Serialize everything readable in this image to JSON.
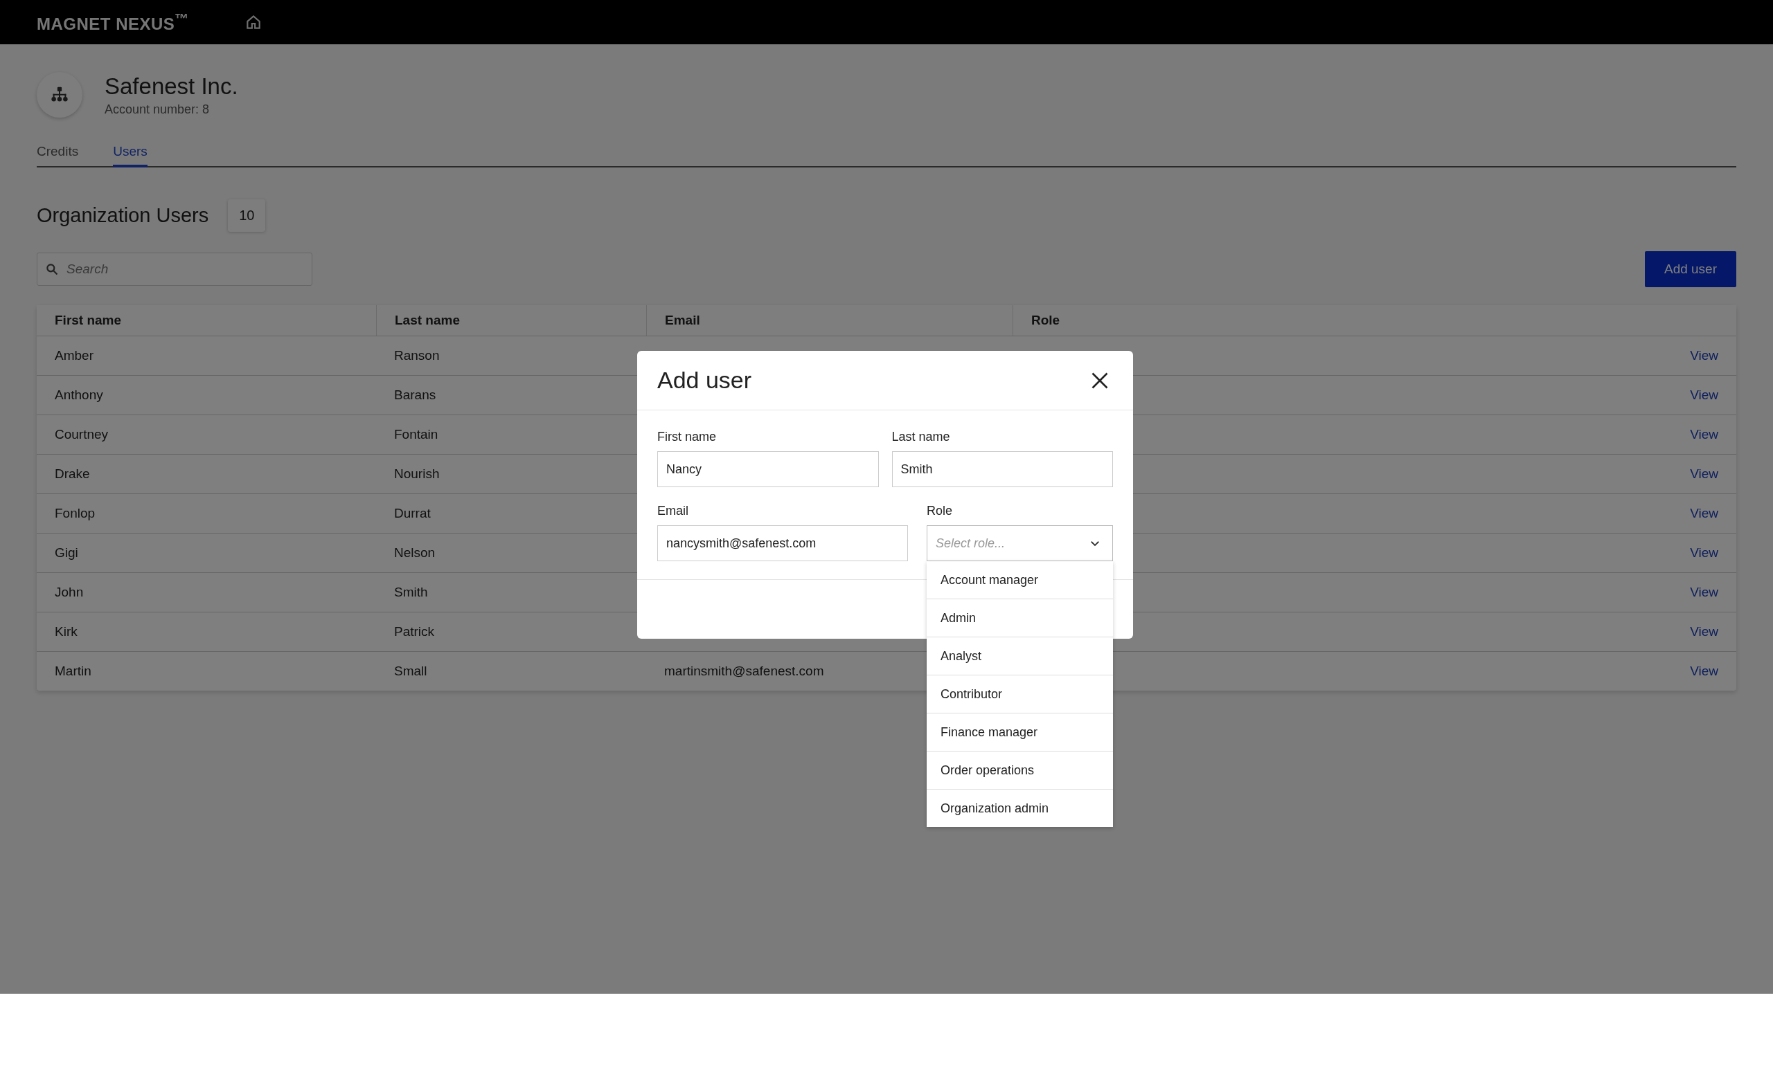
{
  "header": {
    "logo": "MAGNET NEXUS$^{™}$"
  },
  "account": {
    "name": "Safenest Inc.",
    "number": "Account number: 8"
  },
  "tabs": [
    {
      "label": "Credits",
      "selected": false
    },
    {
      "label": "Users",
      "selected": true
    }
  ],
  "section": {
    "title": "Organization Users",
    "count": "10"
  },
  "search": {
    "placeholder": "Search"
  },
  "add_button": "Add user",
  "table": {
    "columns": [
      "First name",
      "Last name",
      "Email",
      "Role"
    ],
    "rows": [
      {
        "first": "Amber",
        "last": "Ranson",
        "action": "View"
      },
      {
        "first": "Anthony",
        "last": "Barans",
        "action": "View"
      },
      {
        "first": "Courtney",
        "last": "Fontain",
        "action": "View"
      },
      {
        "first": "Drake",
        "last": "Nourish",
        "action": "View"
      },
      {
        "first": "Fonlop",
        "last": "Durrat",
        "action": "View"
      },
      {
        "first": "Gigi",
        "last": "Nelson",
        "action": "View"
      },
      {
        "first": "John",
        "last": "Smith",
        "action": "View"
      },
      {
        "first": "Kirk",
        "last": "Patrick",
        "action": "View"
      },
      {
        "first": "Martin",
        "last": "Small",
        "email": "martinsmith@safenest.com",
        "action": "View"
      }
    ]
  },
  "modal": {
    "title": "Add user",
    "rows": [
      [
        {
          "kind": "text",
          "label": "First name",
          "value": "Nancy"
        },
        {
          "kind": "text",
          "label": "Last name",
          "value": "Smith"
        }
      ],
      [
        {
          "kind": "text",
          "label": "Email",
          "value": "nancysmith@safenest.com"
        },
        {
          "kind": "select",
          "label": "Role",
          "placeholder": "Select role...",
          "expanded": true,
          "options": [
            "Account manager",
            "Admin",
            "Analyst",
            "Contributor",
            "Finance manager",
            "Order operations",
            "Organization admin"
          ]
        }
      ]
    ]
  }
}
